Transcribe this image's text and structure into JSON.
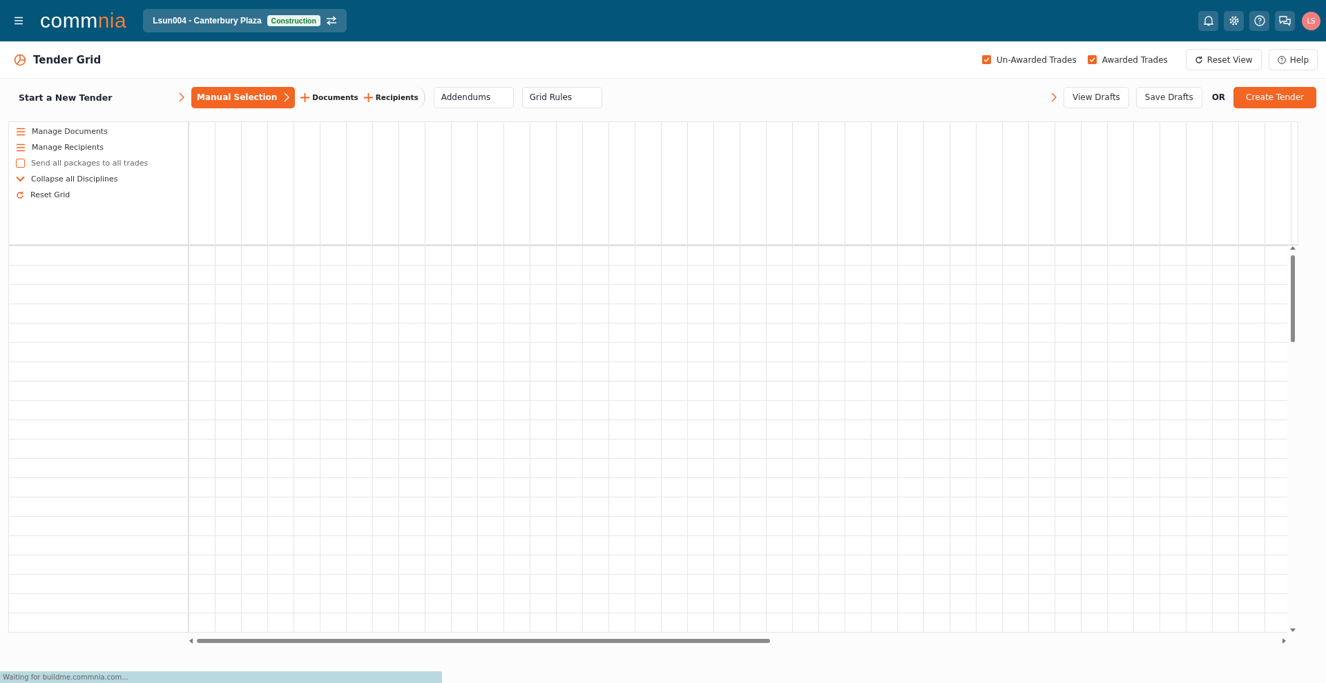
{
  "header": {
    "logo": {
      "primary": "comm",
      "accent": "nia"
    },
    "project": {
      "name": "Lsun004 - Canterbury Plaza",
      "tag": "Construction"
    },
    "avatar": "LS"
  },
  "page": {
    "title": "Tender Grid",
    "filters": [
      {
        "label": "Un-Awarded Trades",
        "checked": true
      },
      {
        "label": "Awarded Trades",
        "checked": true
      }
    ],
    "buttons": [
      "Reset View",
      "Help"
    ]
  },
  "toolbar": {
    "label": "Start a New Tender",
    "steps": [
      {
        "kind": "step",
        "label": "Manual Selection",
        "selected": true
      },
      {
        "kind": "add",
        "label": "Documents",
        "selected": false
      },
      {
        "kind": "add",
        "label": "Recipients",
        "selected": false
      },
      {
        "kind": "field",
        "label": "Addendums",
        "selected": false
      },
      {
        "kind": "field",
        "label": "Grid Rules",
        "selected": false
      }
    ],
    "drafts": [
      "View Drafts",
      "Save Drafts"
    ],
    "or": "OR",
    "create": "Create Tender"
  },
  "grid_actions": [
    {
      "kind": "menu",
      "label": "Manage Documents"
    },
    {
      "kind": "menu",
      "label": "Manage Recipients"
    },
    {
      "kind": "checkbox",
      "label": "Send all packages to all trades",
      "checked": false
    },
    {
      "kind": "collapse",
      "label": "Collapse all Disciplines"
    },
    {
      "kind": "reset",
      "label": "Reset Grid"
    }
  ],
  "status_bar": "Waiting for buildme.commnia.com..."
}
